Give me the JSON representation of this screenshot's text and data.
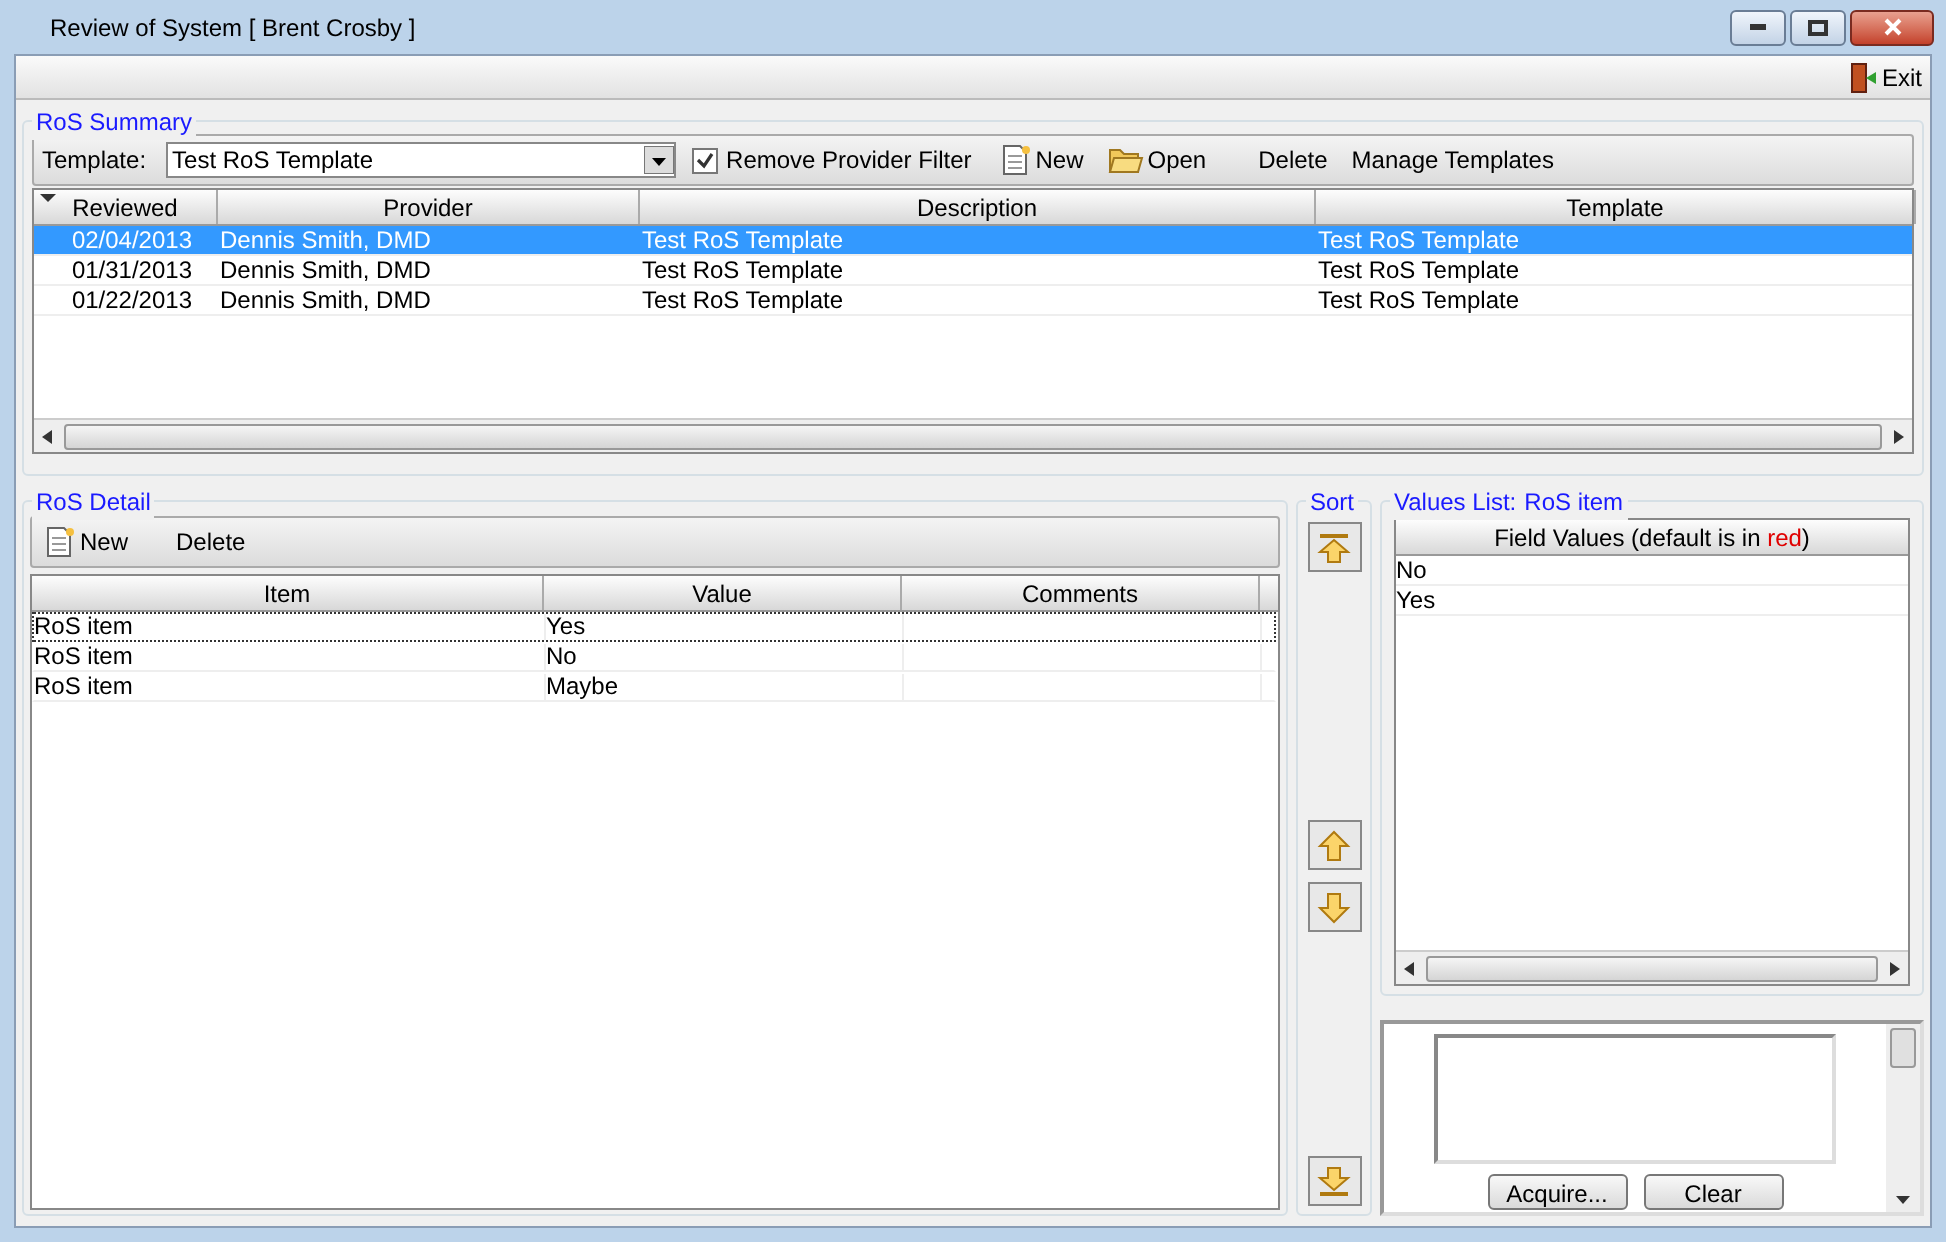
{
  "window": {
    "title": "Review of System [ Brent Crosby ]"
  },
  "toolbar": {
    "exit": "Exit"
  },
  "summary": {
    "title": "RoS Summary",
    "template_label": "Template:",
    "template_value": "Test RoS Template",
    "remove_filter": {
      "label": "Remove Provider Filter",
      "checked": true
    },
    "actions": [
      {
        "kind": "new",
        "label": "New"
      },
      {
        "kind": "open",
        "label": "Open"
      },
      {
        "kind": "plain",
        "label": "Delete"
      },
      {
        "kind": "plain",
        "label": "Manage Templates"
      }
    ],
    "columns": [
      "Reviewed",
      "Provider",
      "Description",
      "Template"
    ],
    "rows": [
      {
        "selected": true,
        "cells": [
          "02/04/2013",
          "Dennis Smith, DMD",
          "Test RoS Template",
          "Test RoS Template"
        ]
      },
      {
        "selected": false,
        "cells": [
          "01/31/2013",
          "Dennis Smith, DMD",
          "Test RoS Template",
          "Test RoS Template"
        ]
      },
      {
        "selected": false,
        "cells": [
          "01/22/2013",
          "Dennis Smith, DMD",
          "Test RoS Template",
          "Test RoS Template"
        ]
      }
    ]
  },
  "detail": {
    "title": "RoS Detail",
    "actions": [
      {
        "kind": "new",
        "label": "New"
      },
      {
        "kind": "plain",
        "label": "Delete"
      }
    ],
    "columns": [
      "Item",
      "Value",
      "Comments"
    ],
    "rows": [
      {
        "selected": true,
        "cells": [
          "RoS item",
          "Yes",
          ""
        ]
      },
      {
        "selected": false,
        "cells": [
          "RoS item",
          "No",
          ""
        ]
      },
      {
        "selected": false,
        "cells": [
          "RoS item",
          "Maybe",
          ""
        ]
      }
    ]
  },
  "sort": {
    "title": "Sort",
    "buttons": [
      {
        "kind": "top"
      },
      {
        "kind": "up"
      },
      {
        "kind": "down"
      },
      {
        "kind": "bottom"
      }
    ]
  },
  "values": {
    "title_label": "Values List:",
    "title_item": "RoS item",
    "header": "Field Values (default is in ",
    "header_highlight": "red",
    "header_end": ")",
    "items": [
      "No",
      "Yes"
    ]
  },
  "capture": {
    "buttons": [
      "Acquire...",
      "Clear"
    ]
  }
}
